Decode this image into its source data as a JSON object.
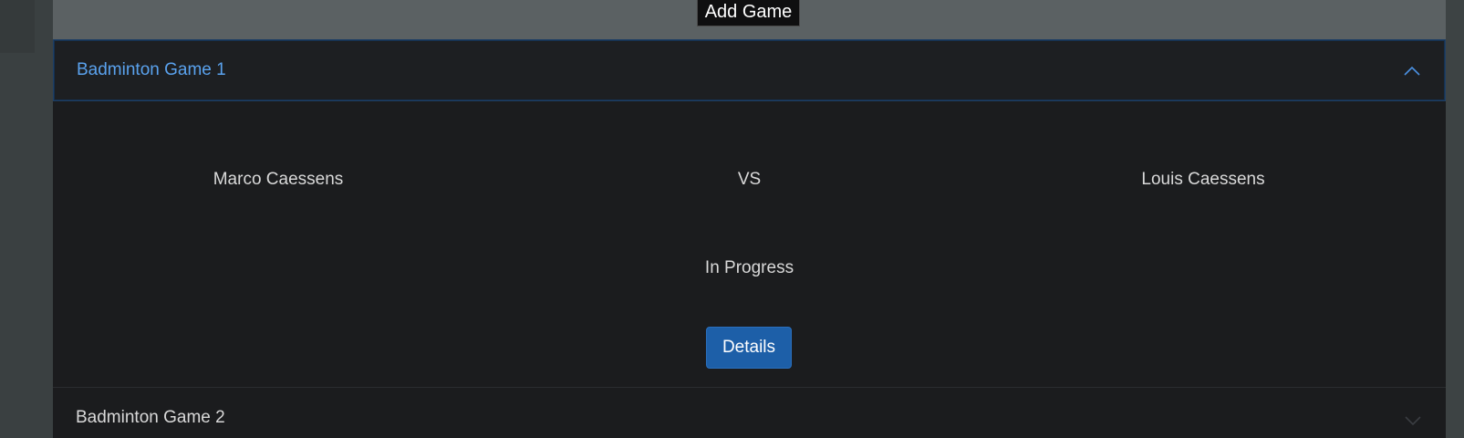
{
  "toolbar": {
    "add_game_label": "Add Game"
  },
  "games": [
    {
      "title": "Badminton Game 1",
      "expanded": true,
      "player_one": "Marco Caessens",
      "versus": "VS",
      "player_two": "Louis Caessens",
      "status": "In Progress",
      "details_label": "Details"
    },
    {
      "title": "Badminton Game 2",
      "expanded": false
    }
  ],
  "icons": {
    "expanded": "chevron-up-icon",
    "collapsed": "chevron-down-icon"
  },
  "colors": {
    "accent": "#5aa2ee",
    "button": "#1d5fa8",
    "background": "#1b1c1e",
    "top_strip": "#5b6163"
  }
}
